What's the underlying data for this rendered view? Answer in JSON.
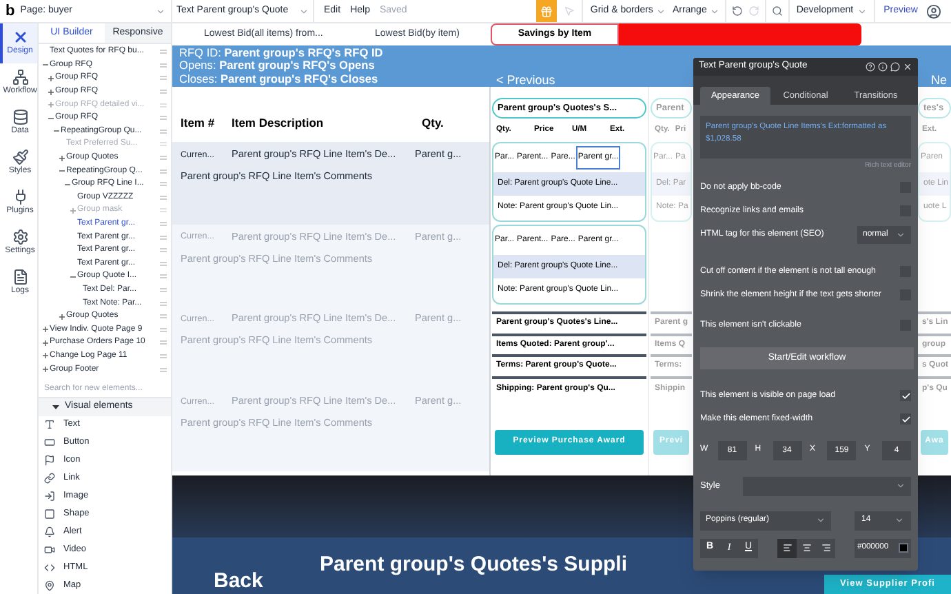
{
  "top_bar": {
    "logo": "b",
    "page": "Page: buyer",
    "element": "Text Parent group's Quote",
    "menus": [
      "Edit",
      "Help"
    ],
    "save_status": "Saved",
    "tools": [
      "Grid & borders",
      "Arrange"
    ],
    "mode": "Development",
    "preview": "Preview"
  },
  "rail": [
    {
      "label": "Design",
      "selected": true
    },
    {
      "label": "Workflow",
      "selected": false
    },
    {
      "label": "Data",
      "selected": false
    },
    {
      "label": "Styles",
      "selected": false
    },
    {
      "label": "Plugins",
      "selected": false
    },
    {
      "label": "Settings",
      "selected": false
    },
    {
      "label": "Logs",
      "selected": false
    }
  ],
  "tree_tabs": [
    {
      "label": "UI Builder",
      "selected": true
    },
    {
      "label": "Responsive",
      "selected": false
    }
  ],
  "tree": [
    {
      "kind": "text",
      "label": "Text Quotes for RFQ bu...",
      "selected": false,
      "hidden": false
    },
    {
      "kind": "group",
      "label": "Group RFQ",
      "expanded": true,
      "selected": false,
      "hidden": false,
      "children": [
        {
          "kind": "group",
          "label": "Group RFQ",
          "expanded": false,
          "selected": false,
          "hidden": false
        },
        {
          "kind": "group",
          "label": "Group RFQ",
          "expanded": false,
          "selected": false,
          "hidden": false
        },
        {
          "kind": "group",
          "label": "Group RFQ detailed vi...",
          "expanded": false,
          "selected": false,
          "hidden": true
        },
        {
          "kind": "group",
          "label": "Group RFQ",
          "expanded": true,
          "selected": false,
          "hidden": false,
          "children": [
            {
              "kind": "group",
              "label": "RepeatingGroup Qu...",
              "expanded": true,
              "selected": false,
              "hidden": false,
              "children": [
                {
                  "kind": "text",
                  "label": "Text Preferred Su...",
                  "selected": false,
                  "hidden": true
                },
                {
                  "kind": "group",
                  "label": "Group Quotes",
                  "expanded": false,
                  "selected": false,
                  "hidden": false
                },
                {
                  "kind": "group",
                  "label": "RepeatingGroup Q...",
                  "expanded": true,
                  "selected": false,
                  "hidden": false,
                  "children": [
                    {
                      "kind": "group",
                      "label": "Group RFQ Line I...",
                      "expanded": true,
                      "selected": false,
                      "hidden": false,
                      "children": [
                        {
                          "kind": "text",
                          "label": "Group VZZZZZ",
                          "selected": false,
                          "hidden": false
                        },
                        {
                          "kind": "group",
                          "label": "Group mask",
                          "expanded": false,
                          "selected": false,
                          "hidden": true
                        },
                        {
                          "kind": "text",
                          "label": "Text Parent gr...",
                          "selected": true,
                          "hidden": false
                        },
                        {
                          "kind": "text",
                          "label": "Text Parent gr...",
                          "selected": false,
                          "hidden": false
                        },
                        {
                          "kind": "text",
                          "label": "Text Parent gr...",
                          "selected": false,
                          "hidden": false
                        },
                        {
                          "kind": "text",
                          "label": "Text Parent gr...",
                          "selected": false,
                          "hidden": false
                        },
                        {
                          "kind": "group",
                          "label": "Group Quote I...",
                          "expanded": true,
                          "selected": false,
                          "hidden": false,
                          "children": [
                            {
                              "kind": "text",
                              "label": "Text Del: Par...",
                              "selected": false,
                              "hidden": false
                            },
                            {
                              "kind": "text",
                              "label": "Text Note: Par...",
                              "selected": false,
                              "hidden": false
                            }
                          ]
                        }
                      ]
                    }
                  ]
                },
                {
                  "kind": "group",
                  "label": "Group Quotes",
                  "expanded": false,
                  "selected": false,
                  "hidden": false
                }
              ]
            }
          ]
        }
      ]
    },
    {
      "kind": "group",
      "label": "View Indiv. Quote Page 9",
      "expanded": false,
      "selected": false,
      "hidden": false
    },
    {
      "kind": "group",
      "label": "Purchase Orders Page 10",
      "expanded": false,
      "selected": false,
      "hidden": false
    },
    {
      "kind": "group",
      "label": "Change Log Page 11",
      "expanded": false,
      "selected": false,
      "hidden": false
    },
    {
      "kind": "group",
      "label": "Group Footer",
      "expanded": false,
      "selected": false,
      "hidden": false
    }
  ],
  "element_search": {
    "placeholder": "Search for new elements..."
  },
  "palette": {
    "title": "Visual elements",
    "expanded": true,
    "items": [
      "Text",
      "Button",
      "Icon",
      "Link",
      "Image",
      "Shape",
      "Alert",
      "Video",
      "HTML",
      "Map"
    ]
  },
  "canvas": {
    "stats": [
      "Lowest Bid(all items) from...",
      "Lowest Bid(by item)"
    ],
    "savings_button": "Savings by Item",
    "rfq_lines": [
      {
        "label": "RFQ ID:",
        "value": "Parent group's RFQ's RFQ ID"
      },
      {
        "label": "Opens:",
        "value": "Parent group's RFQ's Opens"
      },
      {
        "label": "Closes:",
        "value": "Parent group's RFQ's Closes"
      }
    ],
    "previous": "< Previous",
    "next": "Ne",
    "items_table": {
      "columns": [
        "Item #",
        "Item Description",
        "Qty."
      ],
      "rows": [
        {
          "item": "Curren...",
          "description": "Parent group's RFQ Line Item's De...",
          "qty": "Parent g...",
          "comments": "Parent group's RFQ Line Item's Comments",
          "faded": false
        },
        {
          "item": "Curren...",
          "description": "Parent group's RFQ Line Item's De...",
          "qty": "Parent g...",
          "comments": "Parent group's RFQ Line Item's Comments",
          "faded": true
        },
        {
          "item": "Curren...",
          "description": "Parent group's RFQ Line Item's De...",
          "qty": "Parent g...",
          "comments": "Parent group's RFQ Line Item's Comments",
          "faded": true
        },
        {
          "item": "Curren...",
          "description": "Parent group's RFQ Line Item's De...",
          "qty": "Parent g...",
          "comments": "Parent group's RFQ Line Item's Comments",
          "faded": true
        }
      ]
    },
    "quotes": [
      {
        "faded": false,
        "title": "Parent group's Quotes's S...",
        "columns": [
          "Qty.",
          "Price",
          "U/M",
          "Ext."
        ],
        "lines": [
          {
            "cells": [
              {
                "text": "Par...",
                "selected": false
              },
              {
                "text": "Parent...",
                "selected": false
              },
              {
                "text": "Pare...",
                "selected": false
              },
              {
                "text": "Parent gr...",
                "selected": true
              }
            ],
            "del": "Del: Parent group's Quote Line...",
            "note": "Note: Parent group's Quote Lin..."
          },
          {
            "cells": [
              {
                "text": "Par...",
                "selected": false
              },
              {
                "text": "Parent...",
                "selected": false
              },
              {
                "text": "Pare...",
                "selected": false
              },
              {
                "text": "Parent gr...",
                "selected": false
              }
            ],
            "del": "Del: Parent group's Quote Line...",
            "note": "Note: Parent group's Quote Lin..."
          }
        ],
        "summary": [
          "Parent group's Quotes's Line...",
          "Items Quoted: Parent group'...",
          "Terms: Parent group's Quote...",
          "Shipping: Parent group's Qu..."
        ],
        "button": "Preview Purchase Award"
      },
      {
        "faded": true,
        "title": "Parent",
        "columns": [
          "Qty.",
          "Pri"
        ],
        "lines": [
          {
            "cells": [
              {
                "text": "Par...",
                "selected": false
              },
              {
                "text": "Pa",
                "selected": false
              }
            ],
            "del": "Del: Par",
            "note": "Note: Pa"
          }
        ],
        "summary": [
          "Parent g",
          "Items Q",
          "Terms:",
          "Shippin"
        ],
        "button": "Previ"
      },
      {
        "faded": true,
        "title": "tes's",
        "columns": [
          "Ext."
        ],
        "lines": [
          {
            "cells": [
              {
                "text": "Paren",
                "selected": false
              }
            ],
            "del": "ote Lin",
            "note": "uote L"
          }
        ],
        "summary": [
          "s's Lin",
          "group",
          "s Quot",
          "p's Qu"
        ],
        "button": "Awa"
      }
    ],
    "back": "Back",
    "supplier_heading": "Parent group's Quotes's Suppli",
    "supplier_button": "View Supplier Profi"
  },
  "property_panel": {
    "title": "Text Parent group's Quote",
    "tabs": [
      {
        "label": "Appearance",
        "selected": true
      },
      {
        "label": "Conditional",
        "selected": false
      },
      {
        "label": "Transitions",
        "selected": false
      }
    ],
    "content": "Parent group's Quote Line Items's Ext:formatted as $1,028.58",
    "rich_text_link": "Rich text editor",
    "setting_groups": [
      {
        "items": [
          {
            "kind": "checkbox",
            "label": "Do not apply bb-code",
            "checked": false
          },
          {
            "kind": "checkbox",
            "label": "Recognize links and emails",
            "checked": false
          },
          {
            "kind": "select",
            "label": "HTML tag for this element (SEO)",
            "value": "normal"
          }
        ]
      },
      {
        "items": [
          {
            "kind": "checkbox",
            "label": "Cut off content if the element is not tall enough",
            "checked": false
          },
          {
            "kind": "checkbox",
            "label": "Shrink the element height if the text gets shorter",
            "checked": false
          }
        ]
      },
      {
        "items": [
          {
            "kind": "checkbox",
            "label": "This element isn't clickable",
            "checked": false
          },
          {
            "kind": "button",
            "label": "Start/Edit workflow"
          }
        ]
      },
      {
        "items": [
          {
            "kind": "checkbox",
            "label": "This element is visible on page load",
            "checked": true
          },
          {
            "kind": "checkbox",
            "label": "Make this element fixed-width",
            "checked": true
          }
        ]
      }
    ],
    "geometry": [
      {
        "label": "W",
        "value": "81"
      },
      {
        "label": "H",
        "value": "34"
      },
      {
        "label": "X",
        "value": "159"
      },
      {
        "label": "Y",
        "value": "4"
      }
    ],
    "style": {
      "label": "Style"
    },
    "font": "Poppins (regular)",
    "font_size": "14",
    "format": [
      "B",
      "I",
      "U"
    ],
    "align": [
      {
        "selected": true
      },
      {
        "selected": false
      },
      {
        "selected": false
      }
    ],
    "text_color": "#000000"
  }
}
